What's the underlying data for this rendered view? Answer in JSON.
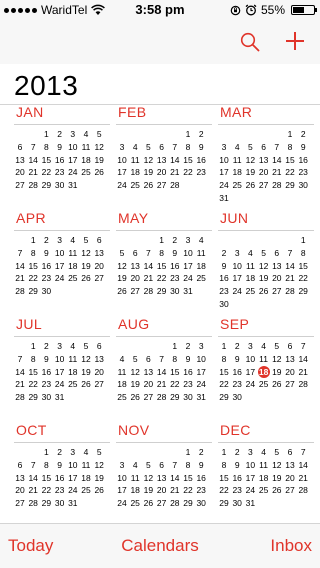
{
  "status_bar": {
    "carrier": "WaridTel",
    "time": "3:58 pm",
    "battery_text": "55%",
    "battery_level": 0.55,
    "signal_dots": 5
  },
  "nav": {
    "search_icon": "search-icon",
    "add_icon": "plus-icon"
  },
  "year": "2013",
  "accent_color": "#e0342a",
  "today": {
    "month_index": 8,
    "day": 18
  },
  "months": [
    {
      "name": "JAN",
      "start": 2,
      "days": 31
    },
    {
      "name": "FEB",
      "start": 5,
      "days": 28
    },
    {
      "name": "MAR",
      "start": 5,
      "days": 31
    },
    {
      "name": "APR",
      "start": 1,
      "days": 30
    },
    {
      "name": "MAY",
      "start": 3,
      "days": 31
    },
    {
      "name": "JUN",
      "start": 6,
      "days": 30
    },
    {
      "name": "JUL",
      "start": 1,
      "days": 31
    },
    {
      "name": "AUG",
      "start": 4,
      "days": 31
    },
    {
      "name": "SEP",
      "start": 0,
      "days": 30
    },
    {
      "name": "OCT",
      "start": 2,
      "days": 31
    },
    {
      "name": "NOV",
      "start": 5,
      "days": 30
    },
    {
      "name": "DEC",
      "start": 0,
      "days": 31
    }
  ],
  "toolbar": {
    "today_label": "Today",
    "calendars_label": "Calendars",
    "inbox_label": "Inbox"
  }
}
